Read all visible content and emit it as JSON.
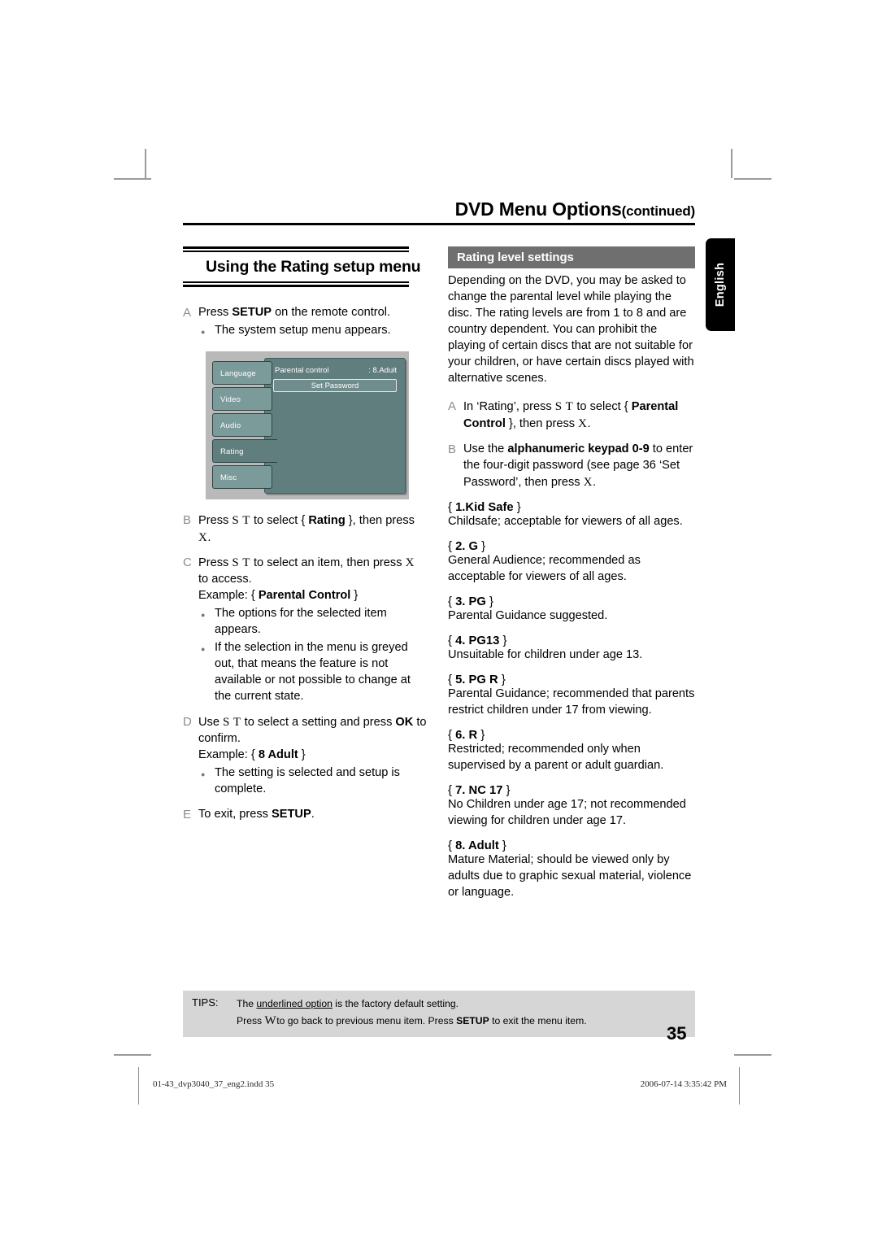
{
  "header": {
    "title": "DVD Menu Options",
    "continued": "(continued)"
  },
  "side_tab": {
    "label": "English"
  },
  "left_column": {
    "section_heading": "Using the Rating setup menu",
    "steps": [
      {
        "letter": "A",
        "text_before": "Press ",
        "bold": "SETUP",
        "text_after": " on the remote control.",
        "bullet": "The system setup menu appears."
      }
    ],
    "tv_screen": {
      "menu_items": [
        "Language",
        "Video",
        "Audio",
        "Rating",
        "Misc"
      ],
      "selected_item": "Rating",
      "field_label": "Parental control",
      "field_value": ": 8.Aduit",
      "button_label": "Set Password"
    },
    "step_b": {
      "letter": "B",
      "text1": "Press ",
      "key1": "S",
      "key2": "T",
      "text2": " to select { ",
      "bold": "Rating",
      "text3": " }, then press ",
      "key3": "X",
      "text4": "."
    },
    "step_c": {
      "letter": "C",
      "text1": "Press ",
      "key1": "S",
      "key2": "T",
      "text2": " to select an item, then press ",
      "key3": "X",
      "text3": " to access.",
      "example_label": "Example: { ",
      "example_bold": "Parental Control",
      "example_close": " }",
      "bullets": [
        "The options for the selected item appears.",
        "If the selection in the menu is greyed out, that means the feature is not available or not possible to change at the current state."
      ]
    },
    "step_d": {
      "letter": "D",
      "text1": "Use ",
      "key1": "S",
      "key2": "T",
      "text2": " to select a setting and press ",
      "bold": "OK",
      "text3": " to confirm.",
      "example_label": "Example: { ",
      "example_bold": "8 Adult",
      "example_close": " }",
      "bullet": "The setting is selected and setup is complete."
    },
    "step_e": {
      "letter": "E",
      "text1": "To exit, press ",
      "bold": "SETUP",
      "text2": "."
    }
  },
  "right_column": {
    "panel_title": "Rating level settings",
    "intro": "Depending on the DVD, you may be asked to change the parental level while playing the disc. The rating levels are from 1 to 8 and are country dependent. You can prohibit the playing of certain discs that are not suitable for your children, or have certain discs played with alternative scenes.",
    "step_a": {
      "letter": "A",
      "text1": "In ‘Rating’, press ",
      "key1": "S",
      "key2": "T",
      "text2": " to select { ",
      "bold": "Parental Control",
      "text3": " }, then press ",
      "key3": "X",
      "text4": "."
    },
    "step_b": {
      "letter": "B",
      "text1": "Use the ",
      "bold": "alphanumeric keypad 0-9",
      "text2": " to enter the four-digit password (see page 36 ‘Set Password’, then press ",
      "key3": "X",
      "text3": "."
    },
    "ratings": [
      {
        "term": "1.Kid Safe",
        "desc": "Childsafe; acceptable for viewers of all ages."
      },
      {
        "term": "2. G",
        "desc": "General Audience; recommended as acceptable for viewers of all ages."
      },
      {
        "term": "3. PG",
        "desc": "Parental Guidance suggested."
      },
      {
        "term": "4. PG13",
        "desc": "Unsuitable for children under age 13."
      },
      {
        "term": "5. PG R",
        "desc": "Parental Guidance; recommended that parents restrict children under 17 from viewing."
      },
      {
        "term": "6. R",
        "desc": "Restricted; recommended only when supervised by a parent or adult guardian."
      },
      {
        "term": "7. NC 17",
        "desc": "No Children under age 17; not recommended viewing for children under age 17."
      },
      {
        "term": "8. Adult",
        "desc": "Mature Material; should be viewed only by adults due to graphic sexual material, violence or language."
      }
    ]
  },
  "tips": {
    "label": "TIPS:",
    "line1_before": "The ",
    "line1_underlined": "underlined option",
    "line1_after": " is the factory default setting.",
    "line2_before": "Press ",
    "line2_key": "W",
    "line2_mid": "to go back to previous menu item. Press ",
    "line2_bold": "SETUP",
    "line2_after": " to exit the menu item."
  },
  "page_number": "35",
  "print_footer": {
    "filename": "01-43_dvp3040_37_eng2.indd   35",
    "datetime": "2006-07-14   3:35:42 PM"
  }
}
